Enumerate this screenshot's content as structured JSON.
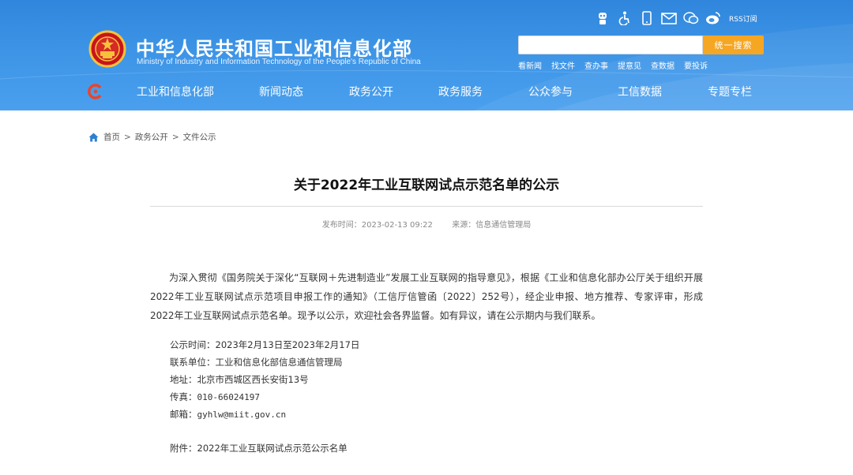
{
  "header": {
    "site_title": "中华人民共和国工业和信息化部",
    "site_subtitle": "Ministry of Industry and Information Technology of the People's Republic of China",
    "rss_label": "RSS订阅",
    "top_icons": [
      "robot-icon",
      "accessibility-icon",
      "mobile-icon",
      "mail-icon",
      "wechat-icon",
      "weibo-icon"
    ],
    "search": {
      "placeholder": "",
      "button_label": "统一搜索"
    },
    "quick_links": [
      "看新闻",
      "找文件",
      "查办事",
      "提意见",
      "查数据",
      "要投诉"
    ],
    "colors": {
      "header_bg": "#3d94e6",
      "search_button": "#f5a623",
      "nav_logo": "#e8452c"
    }
  },
  "nav": {
    "items": [
      "工业和信息化部",
      "新闻动态",
      "政务公开",
      "政务服务",
      "公众参与",
      "工信数据",
      "专题专栏"
    ]
  },
  "breadcrumb": {
    "items": [
      "首页",
      "政务公开",
      "文件公示"
    ],
    "separator": ">"
  },
  "article": {
    "title": "关于2022年工业互联网试点示范名单的公示",
    "publish_time_label": "发布时间：",
    "publish_time": "2023-02-13 09:22",
    "source_label": "来源：",
    "source": "信息通信管理局",
    "paragraph": "为深入贯彻《国务院关于深化“互联网＋先进制造业”发展工业互联网的指导意见》，根据《工业和信息化部办公厅关于组织开展2022年工业互联网试点示范项目申报工作的通知》（工信厅信管函〔2022〕252号），经企业申报、地方推荐、专家评审，形成2022年工业互联网试点示范名单。现予以公示，欢迎社会各界监督。如有异议，请在公示期内与我们联系。",
    "info": {
      "period_label": "公示时间：",
      "period": "2023年2月13日至2023年2月17日",
      "unit_label": "联系单位：",
      "unit": "工业和信息化部信息通信管理局",
      "address_label": "地址：",
      "address": "北京市西城区西长安街13号",
      "fax_label": "传真：",
      "fax": "010-66024197",
      "email_label": "邮箱：",
      "email": "gyhlw@miit.gov.cn",
      "attachment_label": "附件：",
      "attachment": "2022年工业互联网试点示范公示名单"
    }
  }
}
